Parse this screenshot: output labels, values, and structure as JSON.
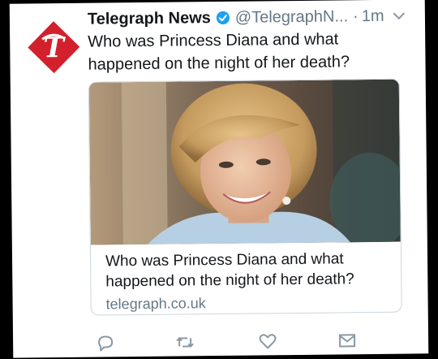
{
  "tweet": {
    "display_name": "Telegraph News",
    "handle": "@TelegraphN...",
    "separator": "·",
    "time": "1m",
    "text": "Who was Princess Diana and what happened on the night of her death?"
  },
  "link_card": {
    "title": "Who was Princess Diana and what happened on the night of her death?",
    "domain": "telegraph.co.uk"
  },
  "icons": {
    "avatar": "telegraph-logo",
    "verified": "verified-badge-icon",
    "menu": "chevron-down-icon",
    "reply": "reply-icon",
    "retweet": "retweet-icon",
    "like": "heart-icon",
    "dm": "envelope-icon"
  },
  "colors": {
    "brand_red": "#d3202d",
    "verified_blue": "#1da1f2",
    "secondary_text": "#657786",
    "icon_gray": "#8899a6"
  }
}
